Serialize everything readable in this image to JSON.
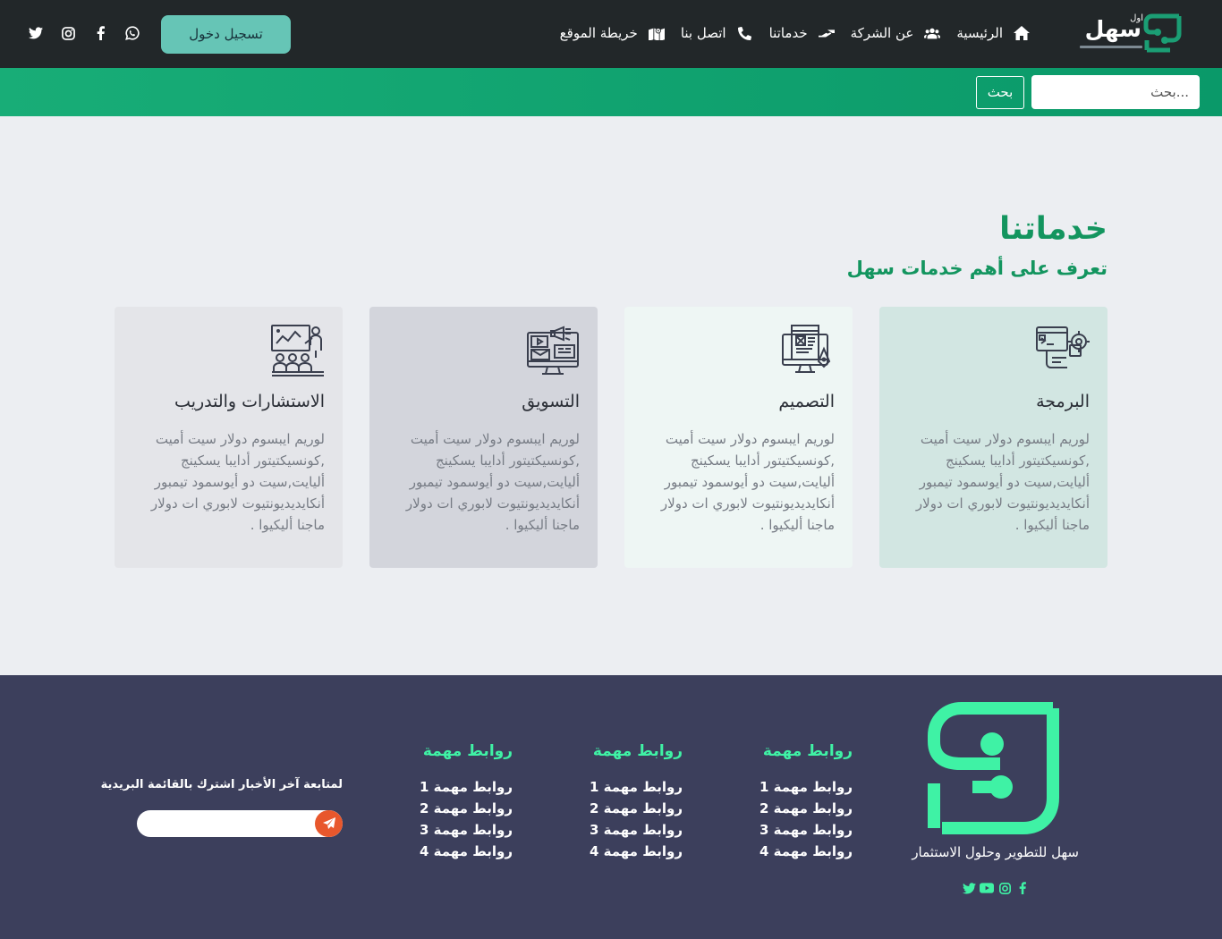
{
  "header": {
    "brand_name": "سهل",
    "brand_small": "اول",
    "login_label": "تسجيل دخول",
    "nav": [
      {
        "label": "الرئيسية",
        "icon": "home-icon"
      },
      {
        "label": "عن الشركة",
        "icon": "users-icon"
      },
      {
        "label": "خدماتنا",
        "icon": "hand-icon"
      },
      {
        "label": "اتصل بنا",
        "icon": "phone-icon"
      },
      {
        "label": "خريطة الموقع",
        "icon": "map-icon"
      }
    ],
    "social": [
      "twitter-icon",
      "instagram-icon",
      "facebook-icon",
      "whatsapp-icon"
    ]
  },
  "search": {
    "placeholder": "بحث...",
    "button_label": "بحث"
  },
  "services": {
    "title": "خدماتنا",
    "subtitle": "تعرف على أهم خدمات سهل",
    "cards": [
      {
        "title": "البرمجة",
        "icon": "programming-icon",
        "bg": "#d2e6e2",
        "text": "لوريم ايبسوم دولار سيت أميت ,كونسيكتيتور أدايبا يسكينج أليايت,سيت دو أيوسمود تيمبور أنكايديديونتيوت لابوري ات دولار ماجنا أليكيوا ."
      },
      {
        "title": "التصميم",
        "icon": "design-icon",
        "bg": "#eef6f4",
        "text": "لوريم ايبسوم دولار سيت أميت ,كونسيكتيتور أدايبا يسكينج أليايت,سيت دو أيوسمود تيمبور أنكايديديونتيوت لابوري ات دولار ماجنا أليكيوا ."
      },
      {
        "title": "التسويق",
        "icon": "marketing-icon",
        "bg": "#d3d5dc",
        "text": "لوريم ايبسوم دولار سيت أميت ,كونسيكتيتور أدايبا يسكينج أليايت,سيت دو أيوسمود تيمبور أنكايديديونتيوت لابوري ات دولار ماجنا أليكيوا ."
      },
      {
        "title": "الاستشارات والتدريب",
        "icon": "training-icon",
        "bg": "#e4e5e9",
        "text": "لوريم ايبسوم دولار سيت أميت ,كونسيكتيتور أدايبا يسكينج أليايت,سيت دو أيوسمود تيمبور أنكايديديونتيوت لابوري ات دولار ماجنا أليكيوا ."
      }
    ]
  },
  "footer": {
    "company": "سهل للتطوير وحلول الاستثمار",
    "social": [
      "twitter-icon",
      "youtube-icon",
      "instagram-icon",
      "facebook-icon"
    ],
    "columns": [
      {
        "title": "روابط مهمة",
        "links": [
          "روابط مهمة 1",
          "روابط مهمة 2",
          "روابط مهمة 3",
          "روابط مهمة 4"
        ]
      },
      {
        "title": "روابط مهمة",
        "links": [
          "روابط مهمة 1",
          "روابط مهمة 2",
          "روابط مهمة 3",
          "روابط مهمة 4"
        ]
      },
      {
        "title": "روابط مهمة",
        "links": [
          "روابط مهمة 1",
          "روابط مهمة 2",
          "روابط مهمة 3",
          "روابط مهمة 4"
        ]
      }
    ],
    "newsletter_label": "لمتابعة آخر الأخبار اشترك بالقائمة البريدية"
  },
  "colors": {
    "accent": "#13955f",
    "footer_accent": "#3ff2a5",
    "topbar": "#222729",
    "footer_bg": "#3c3f5c"
  }
}
